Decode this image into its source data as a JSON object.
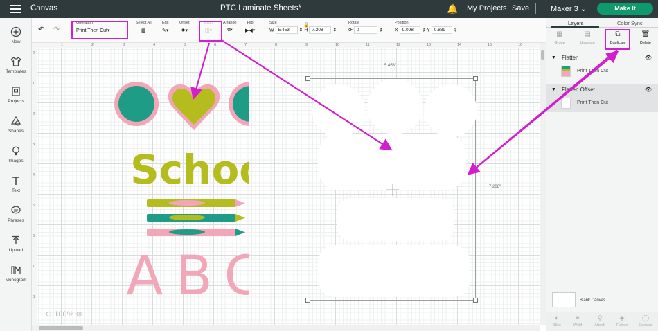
{
  "topbar": {
    "app_title": "Canvas",
    "doc_title": "PTC Laminate Sheets*",
    "my_projects": "My Projects",
    "save": "Save",
    "machine": "Maker 3",
    "make_it": "Make It"
  },
  "leftnav": {
    "items": [
      {
        "label": "New",
        "icon": "plus-circle-icon"
      },
      {
        "label": "Templates",
        "icon": "shirt-icon"
      },
      {
        "label": "Projects",
        "icon": "projects-icon"
      },
      {
        "label": "Shapes",
        "icon": "shapes-icon"
      },
      {
        "label": "Images",
        "icon": "bulb-icon"
      },
      {
        "label": "Text",
        "icon": "text-icon"
      },
      {
        "label": "Phrases",
        "icon": "speech-bubble-icon"
      },
      {
        "label": "Upload",
        "icon": "upload-icon"
      },
      {
        "label": "Monogram",
        "icon": "monogram-icon"
      }
    ]
  },
  "toolbar": {
    "operation_label": "Operation",
    "operation_value": "Print Then Cut",
    "select_all": "Select All",
    "edit": "Edit",
    "offset": "Offset",
    "align": "Align",
    "arrange": "Arrange",
    "flip": "Flip",
    "size": "Size",
    "w_label": "W",
    "w_value": "5.453",
    "h_label": "H",
    "h_value": "7.208",
    "rotate": "Rotate",
    "rotate_value": "0",
    "position": "Position",
    "x_label": "X",
    "x_value": "9.098",
    "y_label": "Y",
    "y_value": "0.889"
  },
  "canvas": {
    "ruler_top": [
      "2",
      "1",
      "2",
      "3",
      "4",
      "5",
      "6",
      "7",
      "8",
      "9",
      "10",
      "11",
      "12",
      "13",
      "14",
      "15",
      "16"
    ],
    "ruler_left": [
      "2",
      "1",
      "2",
      "3",
      "4",
      "5",
      "6",
      "7",
      "8"
    ],
    "width_dim": "5.453\"",
    "height_dim": "7.208\"",
    "word": "School",
    "letters": "ABC",
    "zoom": "100%",
    "colors": {
      "teal": "#1e9c86",
      "pink": "#f2a7b9",
      "olive": "#b5bc1e"
    }
  },
  "rightpanel": {
    "tabs": [
      "Layers",
      "Color Sync"
    ],
    "tools": [
      "Group",
      "Ungroup",
      "Duplicate",
      "Delete"
    ],
    "layers": [
      {
        "name": "Flatten",
        "sub": "Print Then Cut"
      },
      {
        "name": "Flatten Offset",
        "sub": "Print Then Cut"
      }
    ],
    "blank_canvas": "Blank Canvas",
    "bottom_tools": [
      "Slice",
      "Weld",
      "Attach",
      "Flatten",
      "Contour"
    ]
  },
  "annotation_color": "#d21ecc"
}
